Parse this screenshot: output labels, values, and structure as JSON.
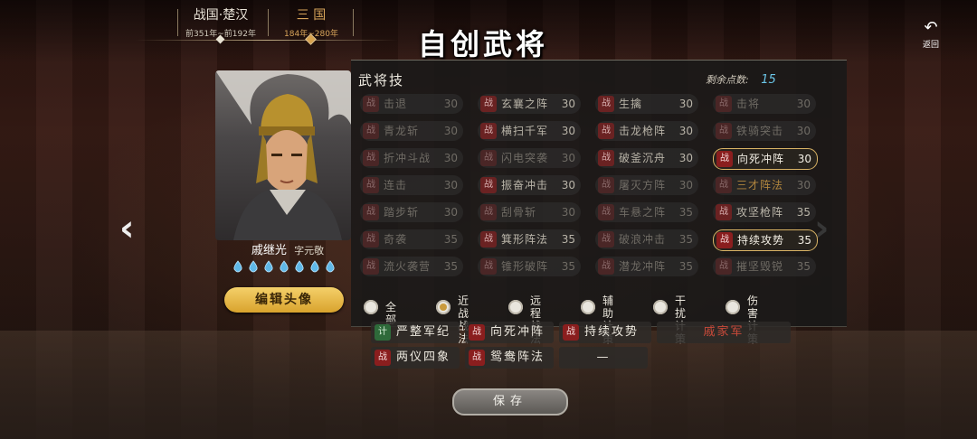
{
  "eras": [
    {
      "name": "战国·楚汉",
      "range": "前351年~前192年"
    },
    {
      "name": "三 国",
      "range": "184年~280年"
    }
  ],
  "title": "自创武将",
  "back_label": "返回",
  "general": {
    "name": "戚继光",
    "courtesy": "字元敬",
    "drops": 7,
    "edit_button": "编辑头像"
  },
  "skills_panel": {
    "title": "武将技",
    "points_label": "剩余点数:",
    "points_value": "15",
    "skills": [
      {
        "tag": "战",
        "name": "击退",
        "cost": "30",
        "state": "dim"
      },
      {
        "tag": "战",
        "name": "玄襄之阵",
        "cost": "30",
        "state": "normal"
      },
      {
        "tag": "战",
        "name": "生擒",
        "cost": "30",
        "state": "normal"
      },
      {
        "tag": "战",
        "name": "击将",
        "cost": "30",
        "state": "dim"
      },
      {
        "tag": "战",
        "name": "青龙斩",
        "cost": "30",
        "state": "dim"
      },
      {
        "tag": "战",
        "name": "横扫千军",
        "cost": "30",
        "state": "normal"
      },
      {
        "tag": "战",
        "name": "击龙枪阵",
        "cost": "30",
        "state": "normal"
      },
      {
        "tag": "战",
        "name": "铁骑突击",
        "cost": "30",
        "state": "dim"
      },
      {
        "tag": "战",
        "name": "折冲斗战",
        "cost": "30",
        "state": "dim"
      },
      {
        "tag": "战",
        "name": "闪电突袭",
        "cost": "30",
        "state": "dim"
      },
      {
        "tag": "战",
        "name": "破釜沉舟",
        "cost": "30",
        "state": "normal"
      },
      {
        "tag": "战",
        "name": "向死冲阵",
        "cost": "30",
        "state": "selected"
      },
      {
        "tag": "战",
        "name": "连击",
        "cost": "30",
        "state": "dim"
      },
      {
        "tag": "战",
        "name": "振奋冲击",
        "cost": "30",
        "state": "normal"
      },
      {
        "tag": "战",
        "name": "屠灭方阵",
        "cost": "30",
        "state": "dim"
      },
      {
        "tag": "战",
        "name": "三才阵法",
        "cost": "30",
        "state": "gold"
      },
      {
        "tag": "战",
        "name": "踏步斩",
        "cost": "30",
        "state": "dim"
      },
      {
        "tag": "战",
        "name": "刮骨斩",
        "cost": "30",
        "state": "dim"
      },
      {
        "tag": "战",
        "name": "车悬之阵",
        "cost": "35",
        "state": "dim"
      },
      {
        "tag": "战",
        "name": "攻坚枪阵",
        "cost": "35",
        "state": "normal"
      },
      {
        "tag": "战",
        "name": "奇袭",
        "cost": "35",
        "state": "dim"
      },
      {
        "tag": "战",
        "name": "箕形阵法",
        "cost": "35",
        "state": "normal"
      },
      {
        "tag": "战",
        "name": "破浪冲击",
        "cost": "35",
        "state": "dim"
      },
      {
        "tag": "战",
        "name": "持续攻势",
        "cost": "35",
        "state": "selected"
      },
      {
        "tag": "战",
        "name": "流火袭营",
        "cost": "35",
        "state": "dim"
      },
      {
        "tag": "战",
        "name": "锥形破阵",
        "cost": "35",
        "state": "dim"
      },
      {
        "tag": "战",
        "name": "潜龙冲阵",
        "cost": "35",
        "state": "dim"
      },
      {
        "tag": "战",
        "name": "摧坚毁锐",
        "cost": "35",
        "state": "dim"
      }
    ],
    "filters": [
      {
        "label1": "全部",
        "label2": "",
        "selected": false
      },
      {
        "label1": "近战",
        "label2": "战法",
        "selected": true
      },
      {
        "label1": "远程",
        "label2": "战法",
        "selected": false
      },
      {
        "label1": "辅助",
        "label2": "计策",
        "selected": false
      },
      {
        "label1": "干扰",
        "label2": "计策",
        "selected": false
      },
      {
        "label1": "伤害",
        "label2": "计策",
        "selected": false
      }
    ]
  },
  "equipped": {
    "row1": [
      {
        "tag": "计",
        "name": "严整军纪"
      },
      {
        "tag": "战",
        "name": "向死冲阵"
      },
      {
        "tag": "战",
        "name": "持续攻势"
      },
      {
        "tag": "",
        "name": "戚家军"
      }
    ],
    "row2": [
      {
        "tag": "战",
        "name": "两仪四象"
      },
      {
        "tag": "战",
        "name": "鸳鸯阵法"
      },
      {
        "tag": "",
        "name": "—"
      }
    ]
  },
  "save_button": "保存",
  "colors": {
    "accent_gold": "#d9b365",
    "points_blue": "#6bc6e8",
    "zhan_tag": "#8a1e1e",
    "ji_tag": "#2e6a3a",
    "era_active": "#d7a45a"
  }
}
